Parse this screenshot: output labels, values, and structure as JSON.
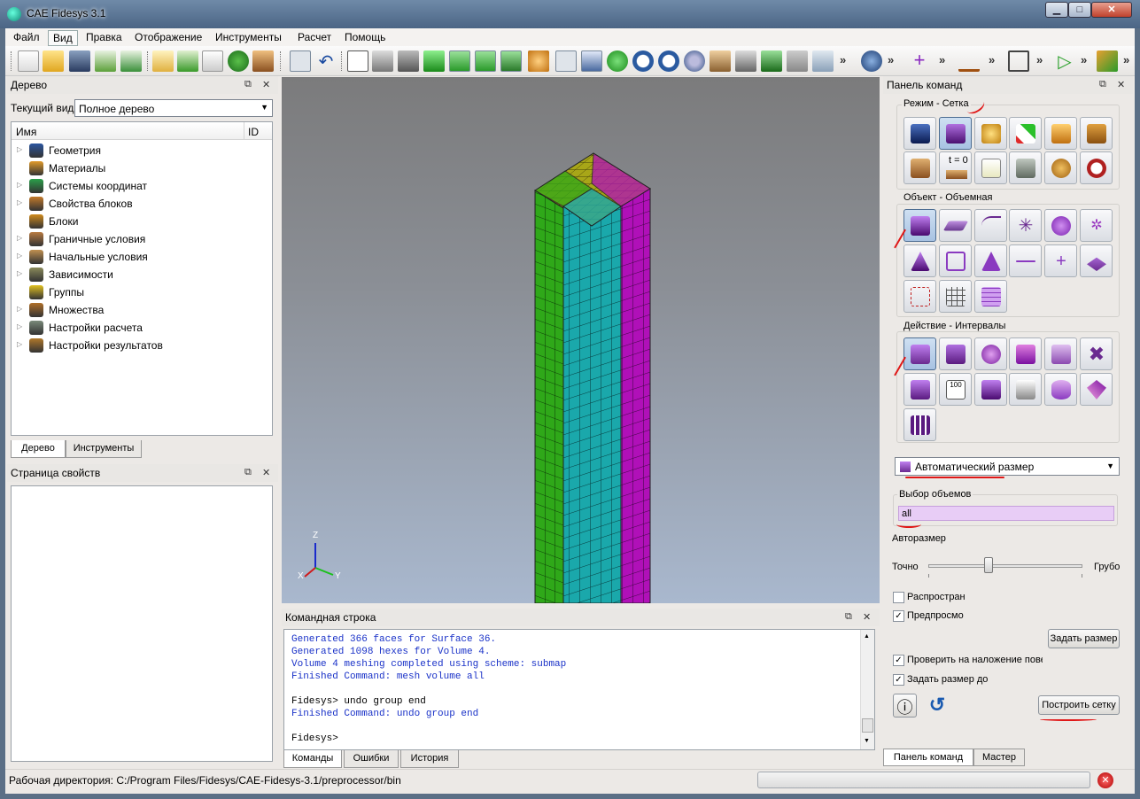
{
  "window": {
    "title": "CAE Fidesys 3.1",
    "minimize": "▁",
    "maximize": "□",
    "close": "✕"
  },
  "menu": [
    "Файл",
    "Вид",
    "Правка",
    "Отображение",
    "Инструменты",
    "Расчет",
    "Помощь"
  ],
  "toolbar": {
    "more": "»"
  },
  "tree_panel": {
    "title": "Дерево",
    "view_label": "Текущий вид",
    "view_value": "Полное дерево",
    "col_name": "Имя",
    "col_id": "ID",
    "items": [
      {
        "label": "Геометрия",
        "icon": "geometry-icon",
        "expand": "▷",
        "color": "#2a55a0"
      },
      {
        "label": "Материалы",
        "icon": "materials-icon",
        "expand": "",
        "color": "#e09a2a"
      },
      {
        "label": "Системы координат",
        "icon": "axes-icon",
        "expand": "▷",
        "color": "#2aa04a"
      },
      {
        "label": "Свойства блоков",
        "icon": "block-properties-icon",
        "expand": "▷",
        "color": "#c47a2a"
      },
      {
        "label": "Блоки",
        "icon": "blocks-icon",
        "expand": "",
        "color": "#d08a1c"
      },
      {
        "label": "Граничные условия",
        "icon": "boundary-conditions-icon",
        "expand": "▷",
        "color": "#b87a40"
      },
      {
        "label": "Начальные условия",
        "icon": "initial-conditions-icon",
        "expand": "▷",
        "color": "#c09050"
      },
      {
        "label": "Зависимости",
        "icon": "dependencies-icon",
        "expand": "▷",
        "color": "#8a8a5a"
      },
      {
        "label": "Группы",
        "icon": "groups-icon",
        "expand": "",
        "color": "#e0c020"
      },
      {
        "label": "Множества",
        "icon": "sets-icon",
        "expand": "▷",
        "color": "#b0702a"
      },
      {
        "label": "Настройки расчета",
        "icon": "calc-settings-icon",
        "expand": "▷",
        "color": "#7a8a7a"
      },
      {
        "label": "Настройки результатов",
        "icon": "results-settings-icon",
        "expand": "▷",
        "color": "#b0782a"
      }
    ],
    "tabs": [
      "Дерево",
      "Инструменты"
    ]
  },
  "properties_panel": {
    "title": "Страница свойств"
  },
  "viewport": {
    "axis_z": "Z",
    "axis_y": "Y",
    "axis_x": "X"
  },
  "command_panel": {
    "title": "Командная строка",
    "lines": [
      {
        "text": "Generated 366 faces for Surface 36.",
        "blue": true
      },
      {
        "text": "Generated 1098 hexes for Volume 4.",
        "blue": true
      },
      {
        "text": "Volume 4 meshing completed using scheme: submap",
        "blue": true
      },
      {
        "text": "Finished Command: mesh volume all",
        "blue": true
      },
      {
        "text": "",
        "blue": false
      },
      {
        "text": "Fidesys> undo group end",
        "blue": false
      },
      {
        "text": "Finished Command: undo group end",
        "blue": true
      },
      {
        "text": "",
        "blue": false
      },
      {
        "text": "Fidesys>",
        "blue": false
      }
    ],
    "tabs": [
      "Команды",
      "Ошибки",
      "История"
    ]
  },
  "right_panel": {
    "title": "Панель команд",
    "mode_group": "Режим - Сетка",
    "object_group": "Объект - Объемная",
    "action_group": "Действие - Интервалы",
    "mode_time_label": "t = 0",
    "interval_type": "Автоматический размер",
    "volume_select_label": "Выбор объемов",
    "volume_select_value": "all",
    "autosize_label": "Авторазмер",
    "fine_label": "Точно",
    "coarse_label": "Грубо",
    "slider_value": 0.39,
    "propagate_label": "Распростран",
    "propagate_checked": "",
    "preview_label": "Предпросмо",
    "preview_checked": "✓",
    "set_size_button": "Задать размер",
    "check_overlap_label": "Проверить на наложение пове",
    "check_overlap_checked": "✓",
    "set_size_to_label": "Задать размер до",
    "set_size_to_checked": "✓",
    "info_icon": "ⓘ",
    "undo_icon": "↺",
    "build_mesh_button": "Построить сетку",
    "tabs": [
      "Панель команд",
      "Мастер"
    ]
  },
  "status_bar": {
    "text": "Рабочая директория: C:/Program Files/Fidesys/CAE-Fidesys-3.1/preprocessor/bin"
  }
}
